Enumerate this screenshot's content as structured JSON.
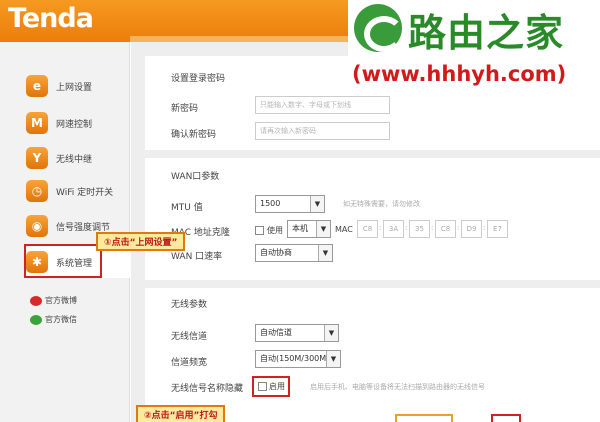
{
  "header": {
    "logo": "Tenda"
  },
  "watermark": {
    "title": "路由之家",
    "url": "(www.hhhyh.com)"
  },
  "sidebar": {
    "items": [
      {
        "label": "上网设置",
        "icon": "ie-icon",
        "glyph": "e"
      },
      {
        "label": "网速控制",
        "icon": "speed-icon",
        "glyph": "M"
      },
      {
        "label": "无线中继",
        "icon": "relay-icon",
        "glyph": "Y"
      },
      {
        "label": "WiFi 定时开关",
        "icon": "wifi-timer-icon",
        "glyph": "◷"
      },
      {
        "label": "信号强度调节",
        "icon": "signal-icon",
        "glyph": "◉"
      },
      {
        "label": "系统管理",
        "icon": "gear-icon",
        "glyph": "✱"
      }
    ],
    "social": [
      {
        "label": "官方微博",
        "icon": "weibo-icon"
      },
      {
        "label": "官方微信",
        "icon": "wechat-icon"
      }
    ]
  },
  "login_password": {
    "title": "设置登录密码",
    "new_password_label": "新密码",
    "new_password_placeholder": "只能输入数字、字母或下划线",
    "confirm_password_label": "确认新密码",
    "confirm_password_placeholder": "请再次输入新密码"
  },
  "wan": {
    "title": "WAN口参数",
    "mtu_label": "MTU 值",
    "mtu_value": "1500",
    "mtu_hint": "如无特殊需要，请勿修改",
    "mac_clone_label": "MAC 地址克隆",
    "mac_use_label": "使用",
    "mac_source_value": "本机",
    "mac_label": "MAC",
    "mac_octets": [
      "C8",
      "3A",
      "35",
      "C8",
      "D9",
      "E7"
    ],
    "rate_label": "WAN 口速率",
    "rate_value": "自动协商"
  },
  "wireless": {
    "title": "无线参数",
    "channel_label": "无线信道",
    "channel_value": "自动信道",
    "bandwidth_label": "信道频宽",
    "bandwidth_value": "自动(150M/300M)",
    "hide_ssid_label": "无线信号名称隐藏",
    "hide_ssid_option": "启用",
    "hide_ssid_hint": "启用后手机、电脑等设备将无法扫描到路由器的无线信号"
  },
  "annotations": {
    "step1": "①点击“上网设置”",
    "step2": "②点击“启用”打勾"
  },
  "colors": {
    "brand_orange": "#f08a14",
    "watermark_green": "#2a8a2a",
    "annotation_red": "#c01818"
  }
}
